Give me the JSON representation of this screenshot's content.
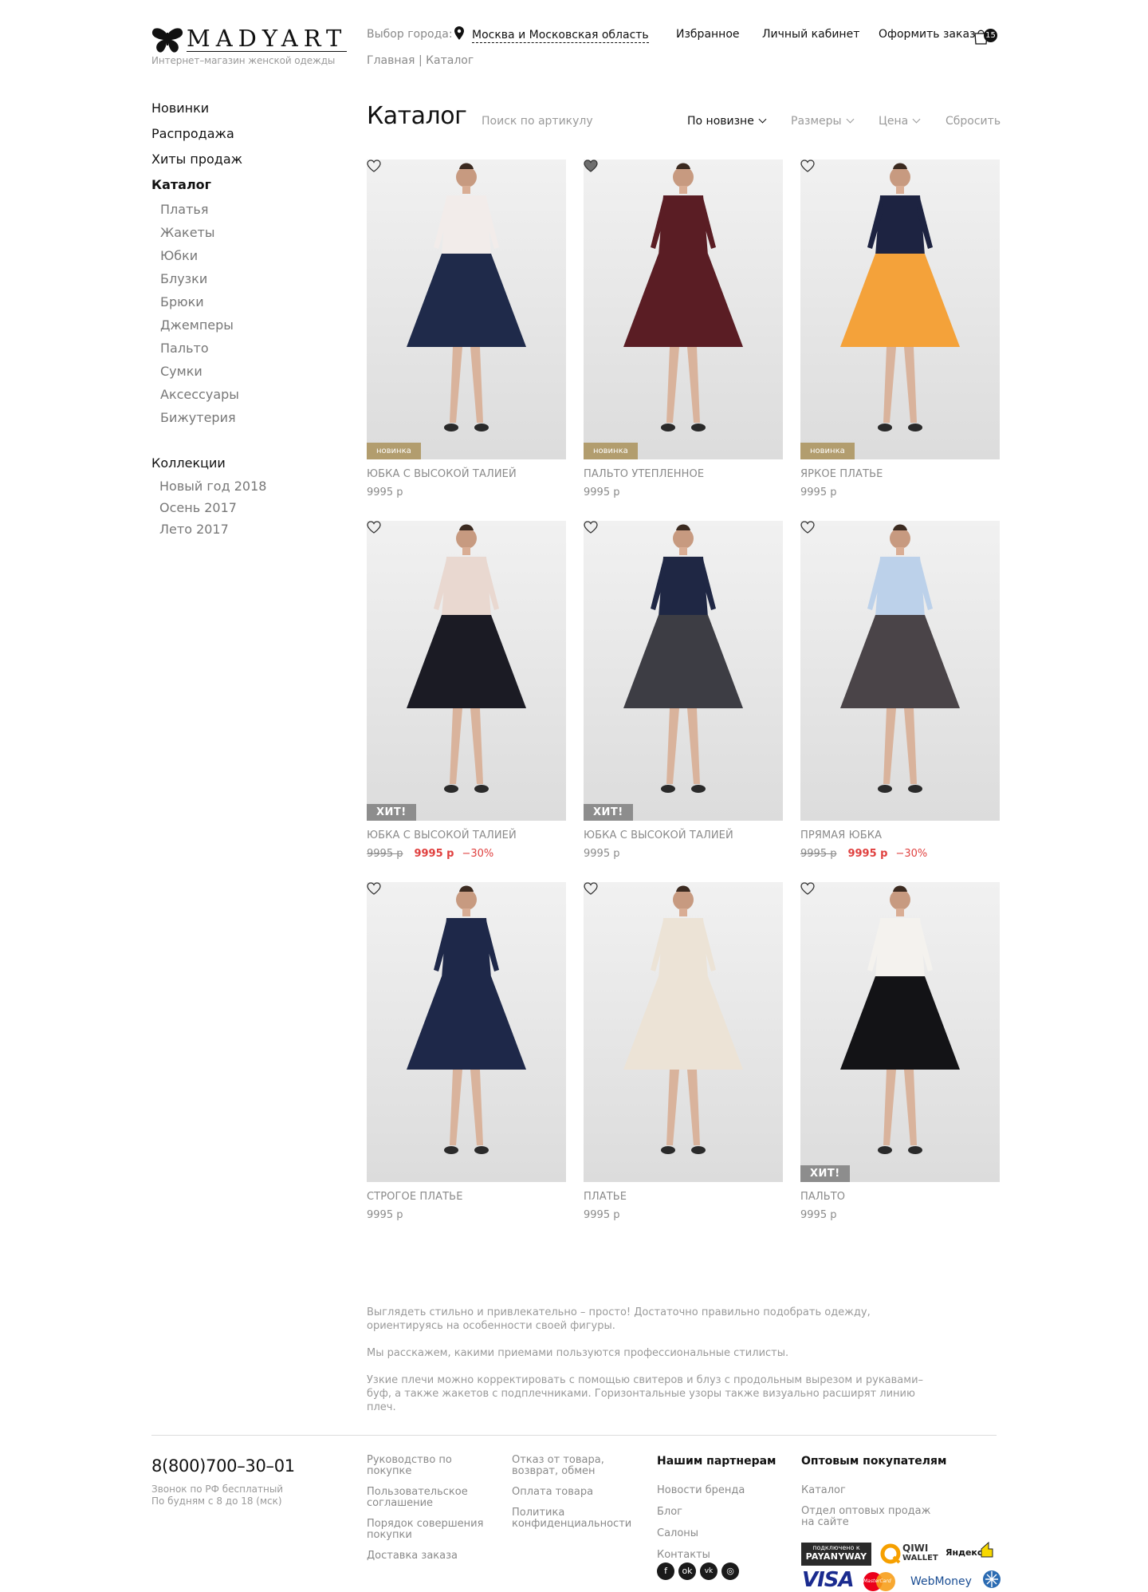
{
  "header": {
    "logo_text": "MADYART",
    "logo_tagline": "Интернет–магазин женской одежды",
    "city_label": "Выбор города:",
    "city_value": "Москва и Московская область",
    "nav": [
      "Избранное",
      "Личный кабинет",
      "Оформить заказ"
    ],
    "cart_count": "15"
  },
  "breadcrumb": {
    "home": "Главная",
    "sep": "|",
    "current": "Каталог"
  },
  "sidebar": {
    "main": [
      {
        "label": "Новинки"
      },
      {
        "label": "Распродажа"
      },
      {
        "label": "Хиты продаж"
      },
      {
        "label": "Каталог",
        "active": true
      }
    ],
    "catalog_items": [
      "Платья",
      "Жакеты",
      "Юбки",
      "Блузки",
      "Брюки",
      "Джемперы",
      "Пальто",
      "Сумки",
      "Аксессуары",
      "Бижутерия"
    ],
    "collections_title": "Коллекции",
    "collections": [
      "Новый год 2018",
      "Осень 2017",
      "Лето 2017"
    ]
  },
  "catalog": {
    "title": "Каталог",
    "search_placeholder": "Поиск по артикулу",
    "sort_new": "По новизне",
    "sizes": "Размеры",
    "price": "Цена",
    "reset": "Сбросить"
  },
  "products": [
    {
      "name": "Юбка с высокой талией",
      "price": "9995 р",
      "badge": "новинка",
      "badge_type": "new",
      "favorite": false,
      "color": "#1f2a4a",
      "top": "#f2ecea"
    },
    {
      "name": "Пальто утепленное",
      "price": "9995 р",
      "badge": "новинка",
      "badge_type": "new",
      "favorite": true,
      "color": "#5a1d24",
      "top": "#5a1d24"
    },
    {
      "name": "Яркое платье",
      "price": "9995 р",
      "badge": "новинка",
      "badge_type": "new",
      "favorite": false,
      "color": "#f4a23a",
      "top": "#1d2341"
    },
    {
      "name": "Юбка с высокой талией",
      "price": "9995 р",
      "old_price": "9995 р",
      "discount": "−30%",
      "badge": "ХИТ!",
      "badge_type": "hit",
      "favorite": false,
      "color": "#1b1b24",
      "top": "#e9d8d0"
    },
    {
      "name": "Юбка с высокой талией",
      "price": "9995 р",
      "badge": "ХИТ!",
      "badge_type": "hit",
      "favorite": false,
      "color": "#3d3d44",
      "top": "#1f2744"
    },
    {
      "name": "Прямая юбка",
      "price": "9995 р",
      "old_price": "9995 р",
      "discount": "−30%",
      "badge": "",
      "badge_type": "",
      "favorite": false,
      "color": "#4a4448",
      "top": "#bcd1ea"
    },
    {
      "name": "Строгое платье",
      "price": "9995 р",
      "badge": "",
      "badge_type": "",
      "favorite": false,
      "color": "#1e2849",
      "top": "#1e2849"
    },
    {
      "name": "Платье",
      "price": "9995 р",
      "badge": "",
      "badge_type": "",
      "favorite": false,
      "color": "#ece3d6",
      "top": "#ece3d6"
    },
    {
      "name": "Пальто",
      "price": "9995 р",
      "badge": "ХИТ!",
      "badge_type": "hit",
      "favorite": false,
      "color": "#131316",
      "top": "#f4f2ee"
    }
  ],
  "seo": [
    "Выглядеть стильно и привлекательно – просто! Достаточно правильно подобрать одежду, ориентируясь на особенности своей фигуры.",
    "Мы расскажем, какими приемами пользуются профессиональные стилисты.",
    "Узкие плечи можно корректировать с помощью свитеров и блуз с продольным вырезом и рукавами–буф, а также жакетов с подплечниками. Горизонтальные узоры также визуально расширят линию плеч."
  ],
  "footer": {
    "phone": "8(800)700–30–01",
    "phone_note_1": "Звонок по РФ бесплатный",
    "phone_note_2": "По будням с 8 до 18 (мск)",
    "col1": [
      "Руководство по покупке",
      "Пользовательское соглашение",
      "Порядок совершения покупки",
      "Доставка заказа"
    ],
    "col2": [
      "Отказ от товара, возврат, обмен",
      "Оплата товара",
      "Политика конфиденциальности"
    ],
    "partners_title": "Нашим партнерам",
    "partners": [
      "Новости бренда",
      "Блог",
      "Салоны",
      "Контакты"
    ],
    "wholesale_title": "Оптовым покупателям",
    "wholesale": [
      "Каталог",
      "Отдел оптовых продаж на сайте"
    ],
    "payment": {
      "payanyway_top": "подключено к",
      "payanyway": "PAYANYWAY",
      "qiwi": "QIWI",
      "qiwi_sub": "WALLET",
      "yandex": "Яндекс",
      "visa": "VISA",
      "mastercard": "MasterCard",
      "webmoney": "WebMoney"
    }
  }
}
